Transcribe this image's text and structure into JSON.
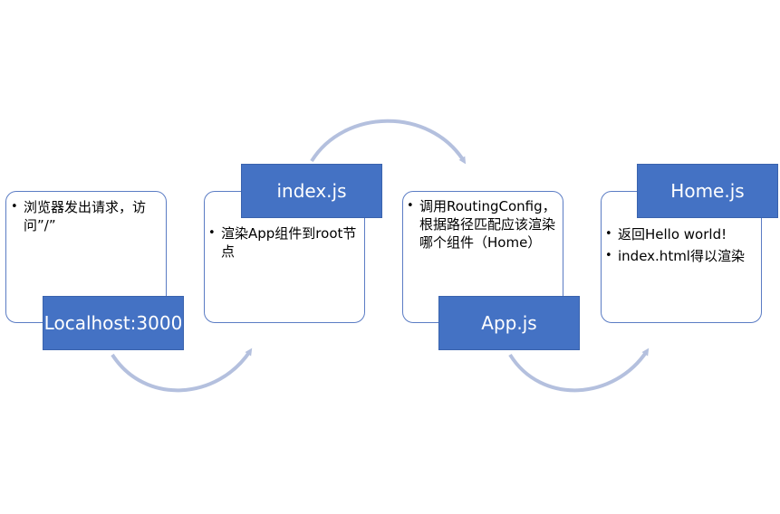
{
  "steps": [
    {
      "label": "Localhost:3000",
      "bullets": [
        "浏览器发出请求，访问”/”"
      ]
    },
    {
      "label": "index.js",
      "bullets": [
        "渲染App组件到root节点"
      ]
    },
    {
      "label": "App.js",
      "bullets": [
        "调用RoutingConfig，根据路径匹配应该渲染哪个组件（Home）"
      ]
    },
    {
      "label": "Home.js",
      "bullets": [
        "返回Hello world!",
        "index.html得以渲染"
      ]
    }
  ],
  "colors": {
    "tag_fill": "#4472c4",
    "card_border": "#5b7cc4",
    "arrow": "#b4c0de"
  }
}
